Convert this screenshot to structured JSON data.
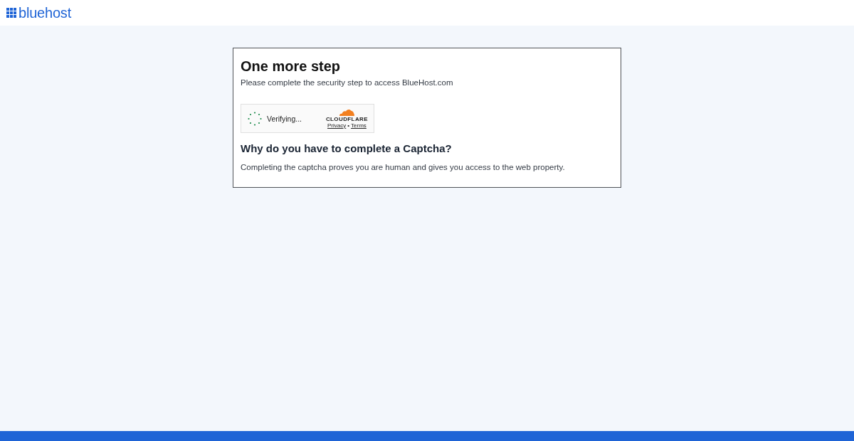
{
  "header": {
    "logo_text": "bluehost"
  },
  "card": {
    "title": "One more step",
    "subtitle": "Please complete the security step to access BlueHost.com",
    "widget": {
      "status": "Verifying...",
      "brand": "CLOUDFLARE",
      "links": [
        "Privacy",
        "Terms"
      ],
      "separator": "•"
    },
    "question": "Why do you have to complete a Captcha?",
    "answer": "Completing the captcha proves you are human and gives you access to the web property."
  }
}
